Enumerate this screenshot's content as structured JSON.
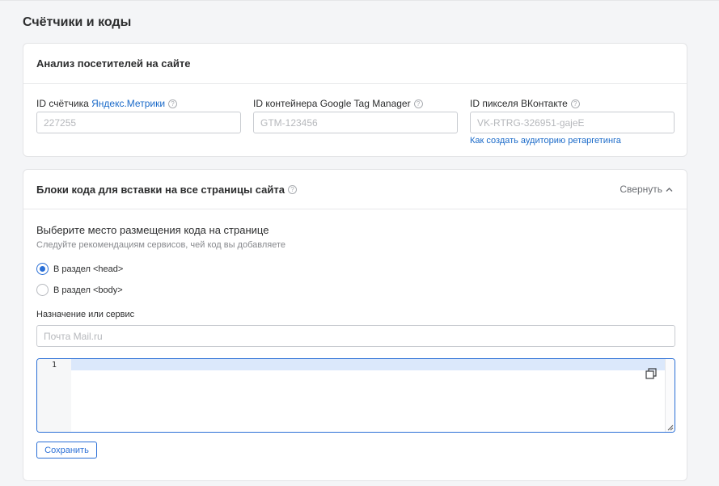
{
  "page": {
    "title": "Счётчики и коды"
  },
  "analytics": {
    "title": "Анализ посетителей на сайте",
    "fields": [
      {
        "label_prefix": "ID счётчика ",
        "label_link": "Яндекс.Метрики",
        "placeholder": "227255",
        "value": ""
      },
      {
        "label": "ID контейнера Google Tag Manager",
        "placeholder": "GTM-123456",
        "value": ""
      },
      {
        "label": "ID пикселя ВКонтакте",
        "placeholder": "VK-RTRG-326951-gajeE",
        "value": "",
        "help_link": "Как создать аудиторию ретаргетинга"
      }
    ]
  },
  "code_blocks": {
    "title": "Блоки кода для вставки на все страницы сайта",
    "collapse_label": "Свернуть",
    "placement_title": "Выберите место размещения кода на странице",
    "placement_subtitle": "Следуйте рекомендациям сервисов, чей код вы добавляете",
    "options": [
      {
        "label": "В раздел <head>",
        "selected": true
      },
      {
        "label": "В раздел <body>",
        "selected": false
      }
    ],
    "purpose_label": "Назначение или сервис",
    "purpose_placeholder": "Почта Mail.ru",
    "purpose_value": "",
    "editor": {
      "line_numbers": [
        "1"
      ],
      "content": ""
    },
    "save_label": "Сохранить"
  },
  "icons": {
    "help": "question-circle-icon",
    "collapse": "chevron-up-icon",
    "copy": "copy-icon",
    "radio_selected": "radio-checked-icon",
    "radio_unselected": "radio-unchecked-icon"
  },
  "colors": {
    "accent": "#2a6fd6",
    "link": "#1a6ac9",
    "background": "#f4f5f7",
    "active_line": "#dbe8fb"
  }
}
